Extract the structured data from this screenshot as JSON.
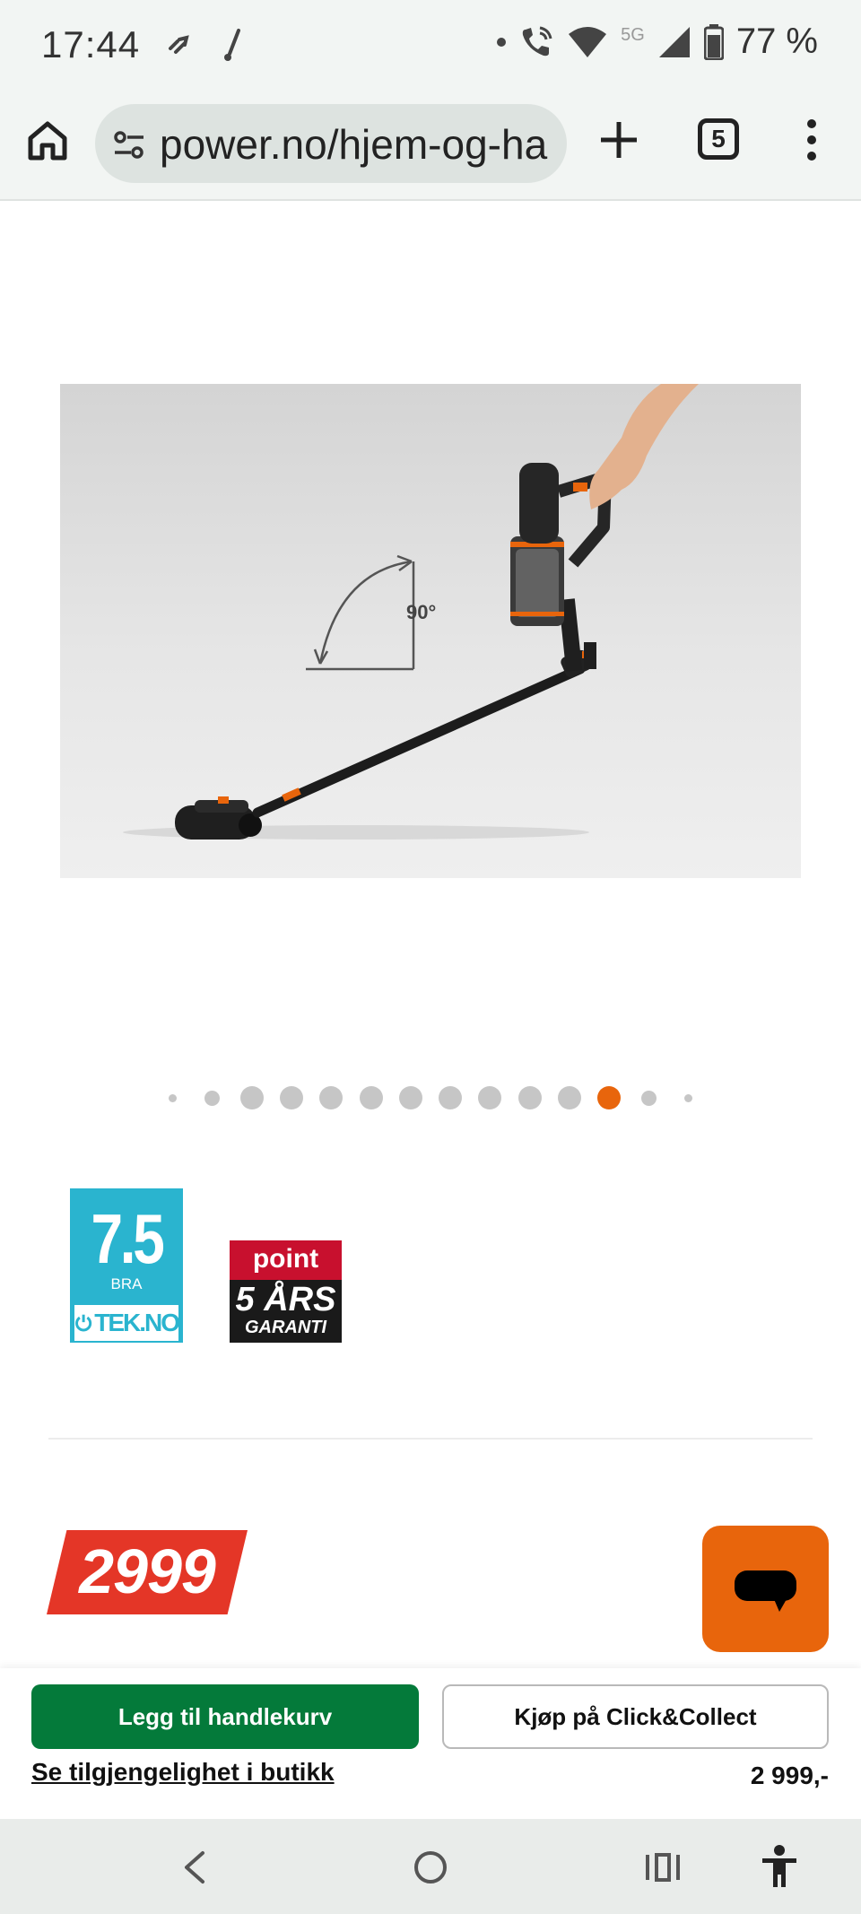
{
  "status_bar": {
    "time": "17:44",
    "network": "5G",
    "battery": "77 %"
  },
  "browser": {
    "url": "power.no/hjem-og-ha",
    "tab_count": "5"
  },
  "product": {
    "image_angle_label": "90°"
  },
  "carousel": {
    "total_dots": 14,
    "active_index": 11
  },
  "badges": {
    "tek": {
      "score": "7.5",
      "grade": "BRA",
      "brand": "TEK.NO"
    },
    "point": {
      "brand": "point",
      "years": "5 ÅRS",
      "label": "GARANTI"
    }
  },
  "price": {
    "tag": "2999",
    "bar_price": "2 999,-"
  },
  "purchase": {
    "add_to_cart": "Legg til handlekurv",
    "click_collect": "Kjøp på Click&Collect",
    "store_availability": "Se tilgjengelighet i butikk"
  },
  "colors": {
    "accent_orange": "#e8650c",
    "cart_green": "#047a3a",
    "price_red": "#e43627",
    "tek_blue": "#2ab4cf"
  }
}
